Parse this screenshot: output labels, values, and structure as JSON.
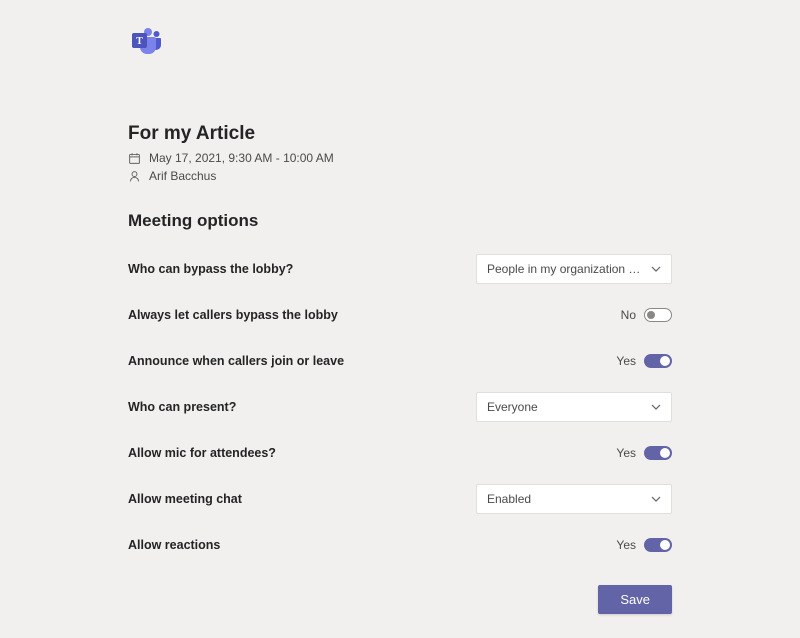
{
  "meeting": {
    "title": "For my Article",
    "datetime": "May 17, 2021, 9:30 AM - 10:00 AM",
    "organizer": "Arif Bacchus"
  },
  "section_heading": "Meeting options",
  "options": {
    "bypass_lobby": {
      "label": "Who can bypass the lobby?",
      "value": "People in my organization and gu…"
    },
    "callers_bypass": {
      "label": "Always let callers bypass the lobby",
      "state_text": "No"
    },
    "announce": {
      "label": "Announce when callers join or leave",
      "state_text": "Yes"
    },
    "who_present": {
      "label": "Who can present?",
      "value": "Everyone"
    },
    "allow_mic": {
      "label": "Allow mic for attendees?",
      "state_text": "Yes"
    },
    "meeting_chat": {
      "label": "Allow meeting chat",
      "value": "Enabled"
    },
    "reactions": {
      "label": "Allow reactions",
      "state_text": "Yes"
    }
  },
  "save_label": "Save"
}
